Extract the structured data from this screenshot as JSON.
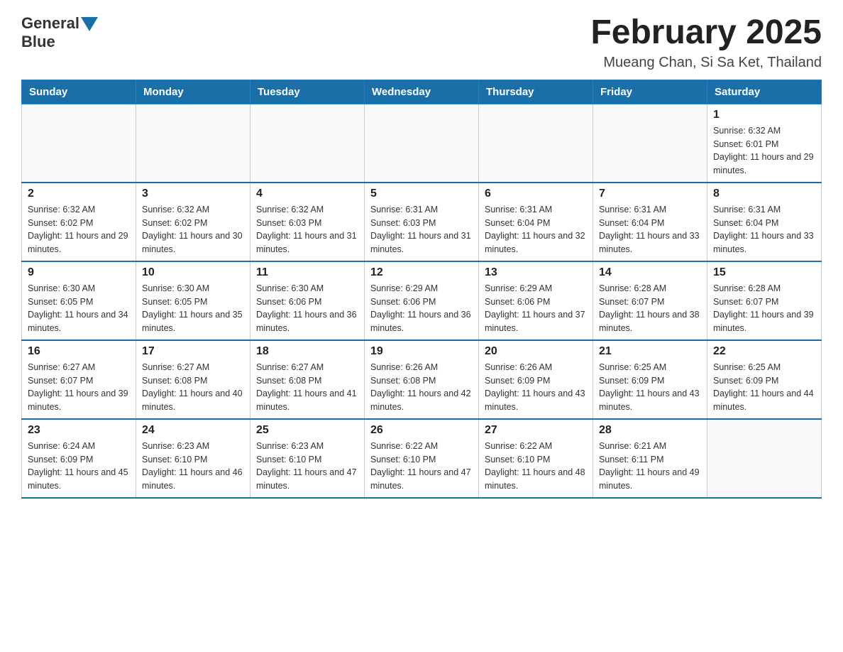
{
  "header": {
    "logo_general": "General",
    "logo_blue": "Blue",
    "title": "February 2025",
    "subtitle": "Mueang Chan, Si Sa Ket, Thailand"
  },
  "weekdays": [
    "Sunday",
    "Monday",
    "Tuesday",
    "Wednesday",
    "Thursday",
    "Friday",
    "Saturday"
  ],
  "weeks": [
    [
      {
        "day": "",
        "info": ""
      },
      {
        "day": "",
        "info": ""
      },
      {
        "day": "",
        "info": ""
      },
      {
        "day": "",
        "info": ""
      },
      {
        "day": "",
        "info": ""
      },
      {
        "day": "",
        "info": ""
      },
      {
        "day": "1",
        "info": "Sunrise: 6:32 AM\nSunset: 6:01 PM\nDaylight: 11 hours and 29 minutes."
      }
    ],
    [
      {
        "day": "2",
        "info": "Sunrise: 6:32 AM\nSunset: 6:02 PM\nDaylight: 11 hours and 29 minutes."
      },
      {
        "day": "3",
        "info": "Sunrise: 6:32 AM\nSunset: 6:02 PM\nDaylight: 11 hours and 30 minutes."
      },
      {
        "day": "4",
        "info": "Sunrise: 6:32 AM\nSunset: 6:03 PM\nDaylight: 11 hours and 31 minutes."
      },
      {
        "day": "5",
        "info": "Sunrise: 6:31 AM\nSunset: 6:03 PM\nDaylight: 11 hours and 31 minutes."
      },
      {
        "day": "6",
        "info": "Sunrise: 6:31 AM\nSunset: 6:04 PM\nDaylight: 11 hours and 32 minutes."
      },
      {
        "day": "7",
        "info": "Sunrise: 6:31 AM\nSunset: 6:04 PM\nDaylight: 11 hours and 33 minutes."
      },
      {
        "day": "8",
        "info": "Sunrise: 6:31 AM\nSunset: 6:04 PM\nDaylight: 11 hours and 33 minutes."
      }
    ],
    [
      {
        "day": "9",
        "info": "Sunrise: 6:30 AM\nSunset: 6:05 PM\nDaylight: 11 hours and 34 minutes."
      },
      {
        "day": "10",
        "info": "Sunrise: 6:30 AM\nSunset: 6:05 PM\nDaylight: 11 hours and 35 minutes."
      },
      {
        "day": "11",
        "info": "Sunrise: 6:30 AM\nSunset: 6:06 PM\nDaylight: 11 hours and 36 minutes."
      },
      {
        "day": "12",
        "info": "Sunrise: 6:29 AM\nSunset: 6:06 PM\nDaylight: 11 hours and 36 minutes."
      },
      {
        "day": "13",
        "info": "Sunrise: 6:29 AM\nSunset: 6:06 PM\nDaylight: 11 hours and 37 minutes."
      },
      {
        "day": "14",
        "info": "Sunrise: 6:28 AM\nSunset: 6:07 PM\nDaylight: 11 hours and 38 minutes."
      },
      {
        "day": "15",
        "info": "Sunrise: 6:28 AM\nSunset: 6:07 PM\nDaylight: 11 hours and 39 minutes."
      }
    ],
    [
      {
        "day": "16",
        "info": "Sunrise: 6:27 AM\nSunset: 6:07 PM\nDaylight: 11 hours and 39 minutes."
      },
      {
        "day": "17",
        "info": "Sunrise: 6:27 AM\nSunset: 6:08 PM\nDaylight: 11 hours and 40 minutes."
      },
      {
        "day": "18",
        "info": "Sunrise: 6:27 AM\nSunset: 6:08 PM\nDaylight: 11 hours and 41 minutes."
      },
      {
        "day": "19",
        "info": "Sunrise: 6:26 AM\nSunset: 6:08 PM\nDaylight: 11 hours and 42 minutes."
      },
      {
        "day": "20",
        "info": "Sunrise: 6:26 AM\nSunset: 6:09 PM\nDaylight: 11 hours and 43 minutes."
      },
      {
        "day": "21",
        "info": "Sunrise: 6:25 AM\nSunset: 6:09 PM\nDaylight: 11 hours and 43 minutes."
      },
      {
        "day": "22",
        "info": "Sunrise: 6:25 AM\nSunset: 6:09 PM\nDaylight: 11 hours and 44 minutes."
      }
    ],
    [
      {
        "day": "23",
        "info": "Sunrise: 6:24 AM\nSunset: 6:09 PM\nDaylight: 11 hours and 45 minutes."
      },
      {
        "day": "24",
        "info": "Sunrise: 6:23 AM\nSunset: 6:10 PM\nDaylight: 11 hours and 46 minutes."
      },
      {
        "day": "25",
        "info": "Sunrise: 6:23 AM\nSunset: 6:10 PM\nDaylight: 11 hours and 47 minutes."
      },
      {
        "day": "26",
        "info": "Sunrise: 6:22 AM\nSunset: 6:10 PM\nDaylight: 11 hours and 47 minutes."
      },
      {
        "day": "27",
        "info": "Sunrise: 6:22 AM\nSunset: 6:10 PM\nDaylight: 11 hours and 48 minutes."
      },
      {
        "day": "28",
        "info": "Sunrise: 6:21 AM\nSunset: 6:11 PM\nDaylight: 11 hours and 49 minutes."
      },
      {
        "day": "",
        "info": ""
      }
    ]
  ]
}
